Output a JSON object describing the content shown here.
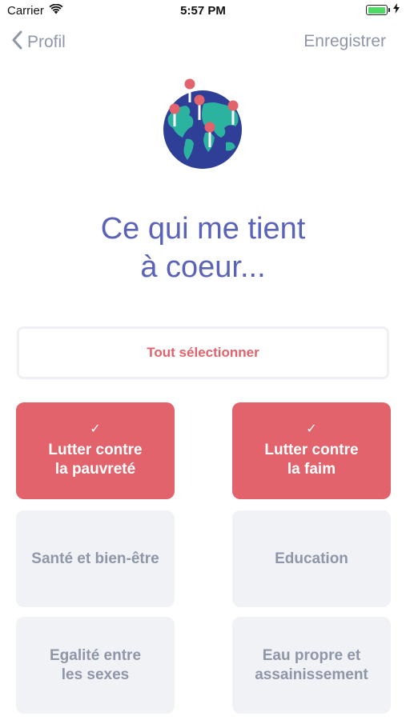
{
  "status_bar": {
    "carrier": "Carrier",
    "time": "5:57 PM",
    "wifi_icon": "wifi-icon",
    "battery_icon": "battery-icon",
    "charging_icon": "bolt-icon"
  },
  "nav": {
    "back_label": "Profil",
    "back_icon": "chevron-left-icon",
    "save_label": "Enregistrer"
  },
  "hero": {
    "icon": "globe-with-pins-icon",
    "title_line1": "Ce qui me tient",
    "title_line2": "à coeur..."
  },
  "select_all": {
    "label": "Tout sélectionner"
  },
  "causes": [
    {
      "label": "Lutter contre\nla pauvreté",
      "selected": true,
      "check": "✓"
    },
    {
      "label": "Lutter contre\nla faim",
      "selected": true,
      "check": "✓"
    },
    {
      "label": "Santé et bien-être",
      "selected": false,
      "check": ""
    },
    {
      "label": "Education",
      "selected": false,
      "check": ""
    },
    {
      "label": "Egalité entre\nles sexes",
      "selected": false,
      "check": ""
    },
    {
      "label": "Eau propre et\nassainissement",
      "selected": false,
      "check": ""
    }
  ],
  "colors": {
    "accent": "#e2636b",
    "title": "#5a63b7",
    "muted": "#8e96a8",
    "card_bg": "#f0f2f6",
    "globe_ocean": "#2f3e96",
    "globe_land": "#2bb3a0"
  }
}
